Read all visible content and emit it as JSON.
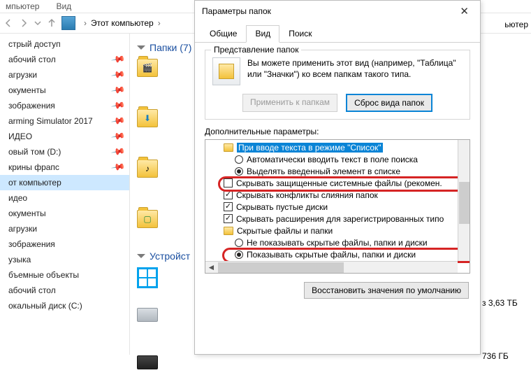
{
  "menu": {
    "computer": "мпьютер",
    "view": "Вид"
  },
  "breadcrumb": {
    "location": "Этот компьютер"
  },
  "nav": {
    "items": [
      "стрый доступ",
      "абочий стол",
      "агрузки",
      "окументы",
      "зображения",
      "arming Simulator 2017",
      "ИДЕО",
      "овый том (D:)",
      "крины фрапс",
      "от компьютер",
      "идео",
      "окументы",
      "агрузки",
      "зображения",
      "узыка",
      "бъемные объекты",
      "абочий стол",
      "окальный диск (C:)"
    ],
    "selected_index": 9
  },
  "content": {
    "section_folders": "Папки (7)",
    "section_devices": "Устройст",
    "sizes": [
      "з 3,63 ТБ",
      "736 ГБ"
    ]
  },
  "dialog": {
    "title": "Параметры папок",
    "tabs": [
      "Общие",
      "Вид",
      "Поиск"
    ],
    "active_tab": 1,
    "group_title": "Представление папок",
    "repr_text": "Вы можете применить этот вид (например, \"Таблица\" или \"Значки\") ко всем папкам такого типа.",
    "btn_apply": "Применить к папкам",
    "btn_reset": "Сброс вида папок",
    "adv_label": "Дополнительные параметры:",
    "tree": {
      "row0": "При вводе текста в режиме \"Список\"",
      "row1": "Автоматически вводить текст в поле поиска",
      "row2": "Выделять введенный элемент в списке",
      "row3": "Скрывать защищенные системные файлы (рекомен.",
      "row4": "Скрывать конфликты слияния папок",
      "row5": "Скрывать пустые диски",
      "row6": "Скрывать расширения для зарегистрированных типо",
      "row7": "Скрытые файлы и папки",
      "row8": "Не показывать скрытые файлы, папки и диски",
      "row9": "Показывать скрытые файлы, папки и диски"
    },
    "btn_restore": "Восстановить значения по умолчанию"
  },
  "partial_text": {
    "right_edge": "ьютер"
  }
}
